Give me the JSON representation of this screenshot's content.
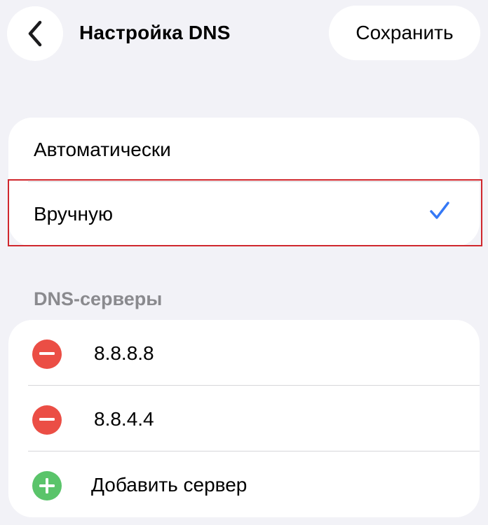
{
  "header": {
    "title": "Настройка DNS",
    "save_label": "Сохранить"
  },
  "mode_options": [
    {
      "label": "Автоматически",
      "selected": false
    },
    {
      "label": "Вручную",
      "selected": true
    }
  ],
  "dns_section": {
    "header": "DNS-серверы",
    "servers": [
      "8.8.8.8",
      "8.8.4.4"
    ],
    "add_label": "Добавить сервер"
  },
  "colors": {
    "accent": "#3478F6",
    "remove": "#EB4E45",
    "add": "#5AC46A",
    "highlight": "#D0272D"
  }
}
